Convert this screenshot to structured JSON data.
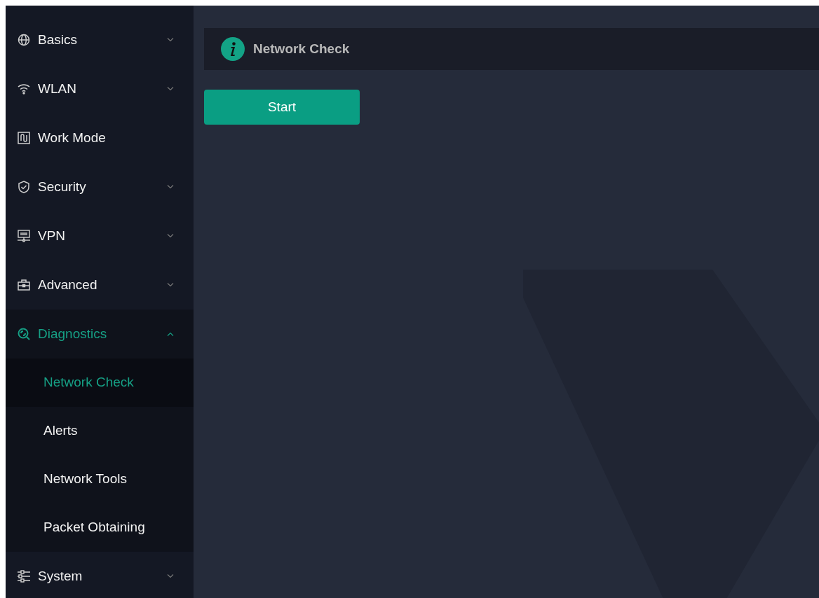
{
  "sidebar": {
    "items": [
      {
        "label": "Basics",
        "expanded": false,
        "selected": false
      },
      {
        "label": "WLAN",
        "expanded": false,
        "selected": false
      },
      {
        "label": "Work Mode",
        "selected": false
      },
      {
        "label": "Security",
        "expanded": false,
        "selected": false
      },
      {
        "label": "VPN",
        "expanded": false,
        "selected": false
      },
      {
        "label": "Advanced",
        "expanded": false,
        "selected": false
      },
      {
        "label": "Diagnostics",
        "expanded": true,
        "selected": true,
        "children": [
          {
            "label": "Network Check",
            "selected": true
          },
          {
            "label": "Alerts",
            "selected": false
          },
          {
            "label": "Network Tools",
            "selected": false
          },
          {
            "label": "Packet Obtaining",
            "selected": false
          }
        ]
      },
      {
        "label": "System",
        "expanded": false,
        "selected": false
      }
    ]
  },
  "page_header": {
    "title": "Network Check"
  },
  "start_button": {
    "label": "Start"
  }
}
